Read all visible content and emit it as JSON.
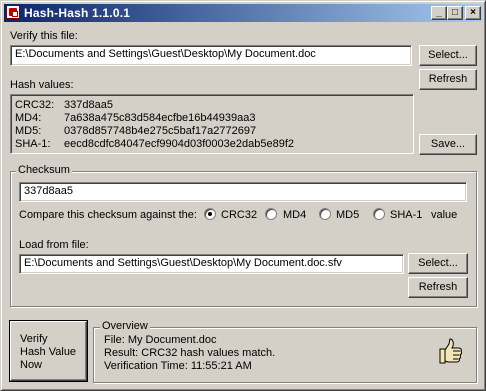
{
  "window": {
    "title": "Hash-Hash 1.1.0.1",
    "minimize_glyph": "_",
    "maximize_glyph": "□",
    "close_glyph": "×"
  },
  "verify": {
    "label": "Verify this file:",
    "file_path": "E:\\Documents and Settings\\Guest\\Desktop\\My Document.doc",
    "select_button": "Select...",
    "refresh_button": "Refresh"
  },
  "hash_values": {
    "label": "Hash values:",
    "rows": [
      {
        "name": "CRC32:",
        "value": "337d8aa5"
      },
      {
        "name": "MD4:",
        "value": "7a638a475c83d584ecfbe16b44939aa3"
      },
      {
        "name": "MD5:",
        "value": "0378d857748b4e275c5baf17a2772697"
      },
      {
        "name": "SHA-1:",
        "value": "eecd8cdfc84047ecf9904d03f0003e2dab5e89f2"
      }
    ],
    "save_button": "Save..."
  },
  "checksum": {
    "group_title": "Checksum",
    "value": "337d8aa5",
    "compare_label": "Compare this checksum against the:",
    "options": [
      {
        "label": "CRC32",
        "selected": true
      },
      {
        "label": "MD4",
        "selected": false
      },
      {
        "label": "MD5",
        "selected": false
      },
      {
        "label": "SHA-1",
        "selected": false
      }
    ],
    "value_suffix": "value",
    "load_label": "Load from file:",
    "load_path": "E:\\Documents and Settings\\Guest\\Desktop\\My Document.doc.sfv",
    "select_button": "Select...",
    "refresh_button": "Refresh"
  },
  "verify_now": {
    "line1": "Verify",
    "line2": "Hash Value",
    "line3": "Now"
  },
  "overview": {
    "title": "Overview",
    "file_line": "File: My Document.doc",
    "result_line": "Result: CRC32 hash values match.",
    "time_line": "Verification Time: 11:55:21 AM",
    "icon": "thumbs-up-icon"
  }
}
